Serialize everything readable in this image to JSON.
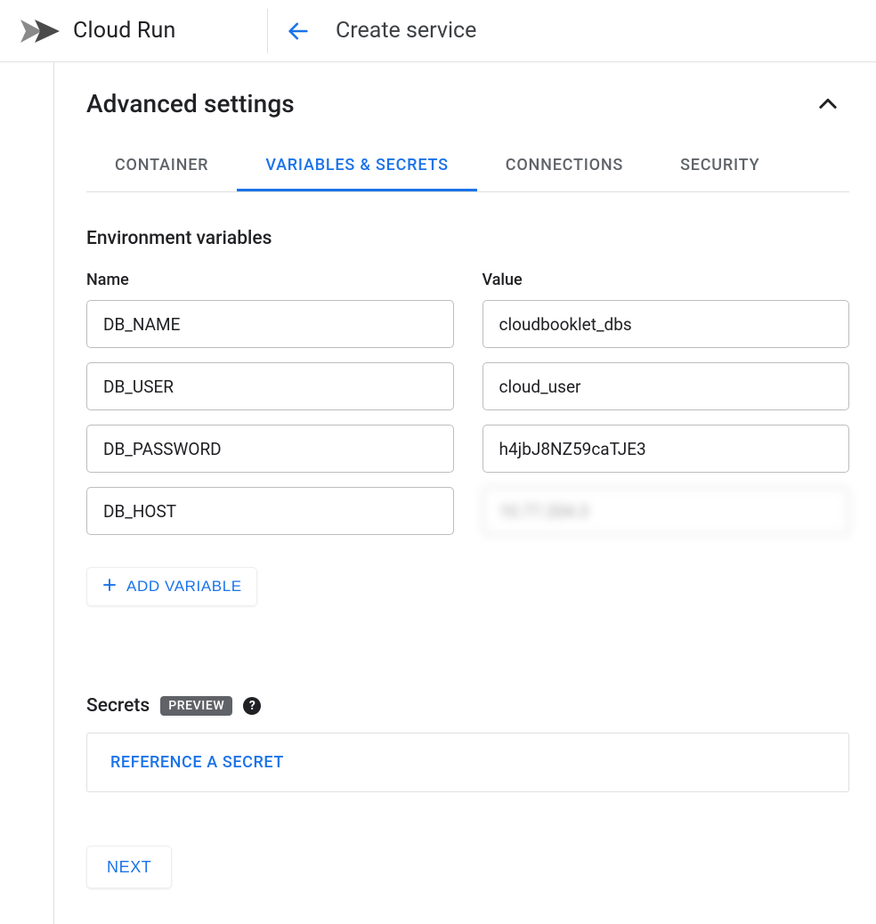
{
  "header": {
    "product": "Cloud Run",
    "page_title": "Create service"
  },
  "panel": {
    "title": "Advanced settings"
  },
  "tabs": {
    "container": "CONTAINER",
    "variables": "VARIABLES & SECRETS",
    "connections": "CONNECTIONS",
    "security": "SECURITY"
  },
  "env": {
    "section_title": "Environment variables",
    "name_header": "Name",
    "value_header": "Value",
    "rows": [
      {
        "name": "DB_NAME",
        "value": "cloudbooklet_dbs"
      },
      {
        "name": "DB_USER",
        "value": "cloud_user"
      },
      {
        "name": "DB_PASSWORD",
        "value": "h4jbJ8NZ59caTJE3"
      },
      {
        "name": "DB_HOST",
        "value": "10.77.204.3"
      }
    ],
    "add_label": "ADD VARIABLE"
  },
  "secrets": {
    "title": "Secrets",
    "badge": "PREVIEW",
    "reference": "REFERENCE A SECRET"
  },
  "next_label": "NEXT"
}
